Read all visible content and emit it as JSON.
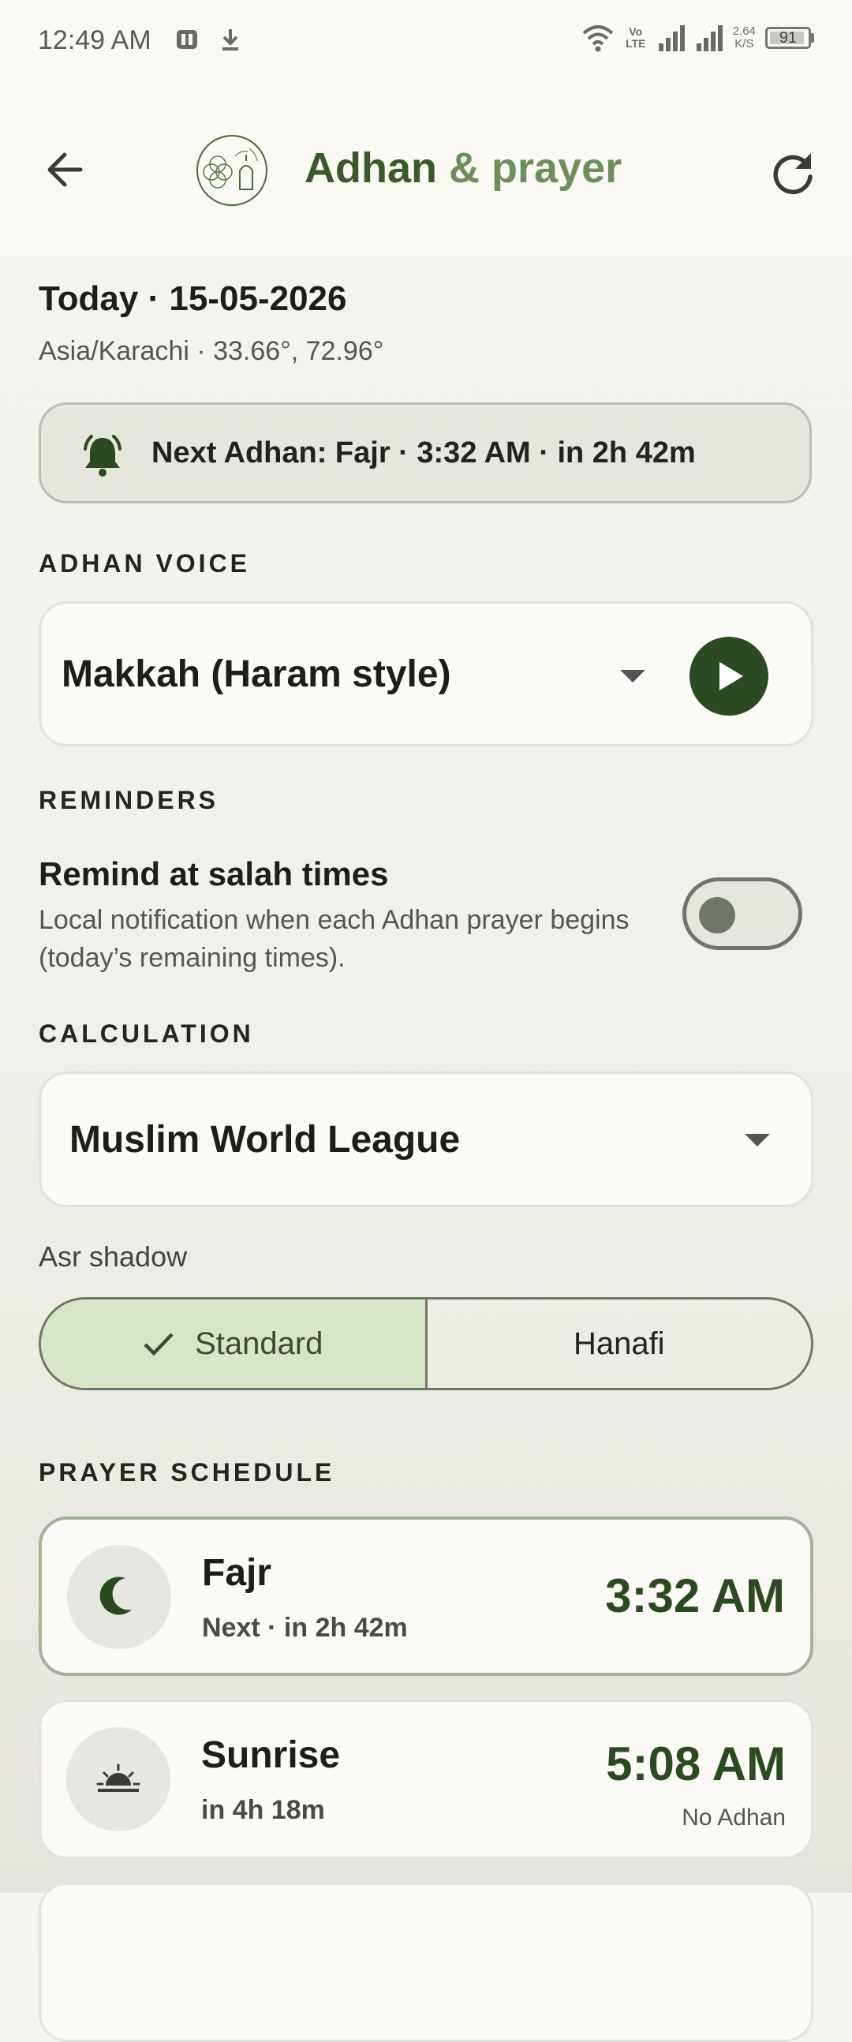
{
  "status_bar": {
    "time": "12:49 AM",
    "network_label": "Vo LTE",
    "speed_value": "2.64",
    "speed_unit": "K/S",
    "battery": "91"
  },
  "header": {
    "title_part1": "Adhan",
    "title_part2": "& prayer",
    "logo_icon": "crescent-mosque-logo-icon",
    "refresh_icon": "refresh-icon",
    "back_icon": "arrow-left-icon"
  },
  "today": {
    "date_line": "Today · 15-05-2026",
    "location_line": "Asia/Karachi · 33.66°, 72.96°"
  },
  "next_adhan": {
    "text": "Next Adhan: Fajr · 3:32 AM · in 2h 42m",
    "icon": "bell-icon"
  },
  "adhan_voice": {
    "section_label": "ADHAN VOICE",
    "selected": "Makkah (Haram style)"
  },
  "reminders": {
    "section_label": "REMINDERS",
    "title": "Remind at salah times",
    "subtitle": "Local notification when each Adhan prayer begins (today’s remaining times).",
    "enabled": false
  },
  "calculation": {
    "section_label": "CALCULATION",
    "selected": "Muslim World League"
  },
  "asr_shadow": {
    "label": "Asr shadow",
    "options": [
      "Standard",
      "Hanafi"
    ],
    "selected": "Standard"
  },
  "schedule": {
    "section_label": "PRAYER SCHEDULE",
    "items": [
      {
        "name": "Fajr",
        "sub": "Next · in 2h 42m",
        "time": "3:32 AM",
        "note": "",
        "icon": "crescent-moon-icon",
        "is_next": true
      },
      {
        "name": "Sunrise",
        "sub": "in 4h 18m",
        "time": "5:08 AM",
        "note": "No Adhan",
        "icon": "sunrise-icon",
        "is_next": false
      }
    ]
  },
  "colors": {
    "accent_dark_green": "#2c4a22",
    "title_green": "#3a5a2c",
    "title_light_green": "#6e8f5a",
    "selected_segment": "#d7e5c8",
    "background": "#f1f0ea"
  }
}
